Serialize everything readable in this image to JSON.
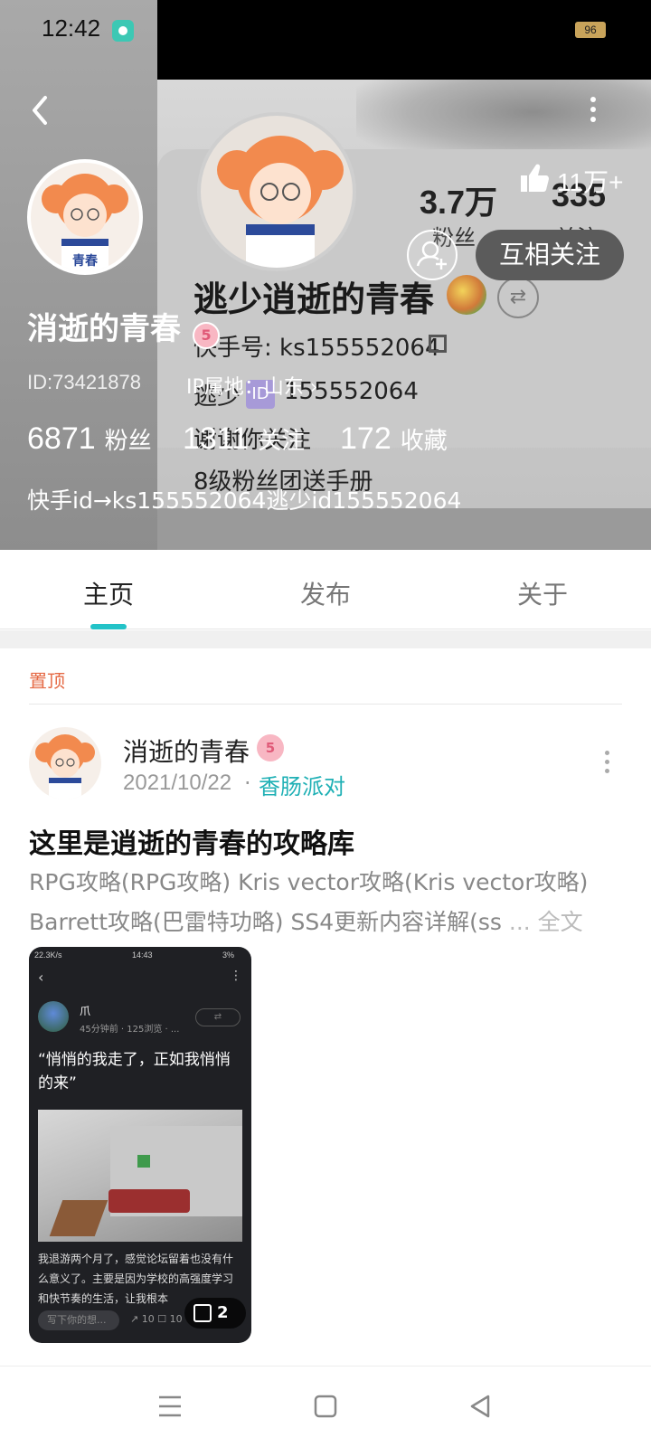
{
  "status_bar": {
    "time": "12:42",
    "battery": "96"
  },
  "background_snapshot": {
    "stat1_value": "3.7万",
    "stat1_label": "粉丝",
    "stat2_value": "335",
    "stat2_label": "关注",
    "name": "逃少逍逝的青春",
    "line1": "快手号: ks155552064",
    "line2_prefix": "逃少",
    "line2_badge": "ID",
    "line2_suffix": "155552064",
    "line3": "谢谢你关注",
    "line4": "8级粉丝团送手册"
  },
  "profile": {
    "avatar_text": "青春",
    "likes": "11万+",
    "follow_button": "互相关注",
    "name": "消逝的青春",
    "level_badge": "5",
    "id": "ID:73421878",
    "ip": "IP属地：山东 ›",
    "stats": [
      {
        "value": "6871",
        "label": "粉丝"
      },
      {
        "value": "1311",
        "label": "关注"
      },
      {
        "value": "172",
        "label": "收藏"
      }
    ],
    "bio": "快手id→ks155552064逃少id155552064"
  },
  "tabs": [
    {
      "label": "主页",
      "active": true
    },
    {
      "label": "发布",
      "active": false
    },
    {
      "label": "关于",
      "active": false
    }
  ],
  "pinned_label": "置顶",
  "post": {
    "author": "消逝的青春",
    "level_badge": "5",
    "date": "2021/10/22",
    "dot": "·",
    "tag": "香肠派对",
    "title": "这里是逍逝的青春的攻略库",
    "line1": "RPG攻略(RPG攻略) Kris vector攻略(Kris  vector攻略)",
    "line2": "Barrett攻略(巴雷特功略) SS4更新内容详解(ss",
    "ellipsis": " ... 全文",
    "thumbnail": {
      "status": "22.3K/s",
      "status_time": "14:43",
      "status_battery": "3%",
      "user": "爪",
      "meta": "45分钟前 · 125浏览 · ...",
      "quote": "“悄悄的我走了，正如我悄悄的来”",
      "text": "我退游两个月了，感觉论坛留着也没有什么意义了。主要是因为学校的高强度学习和快节奏的生活，让我根本",
      "input_placeholder": "写下你的想...",
      "actions": "↗ 10    ☐ 10",
      "image_count": "2"
    }
  },
  "colors": {
    "accent": "#23c3c8",
    "pinned": "#e56a45",
    "tag": "#1fb0b5"
  }
}
